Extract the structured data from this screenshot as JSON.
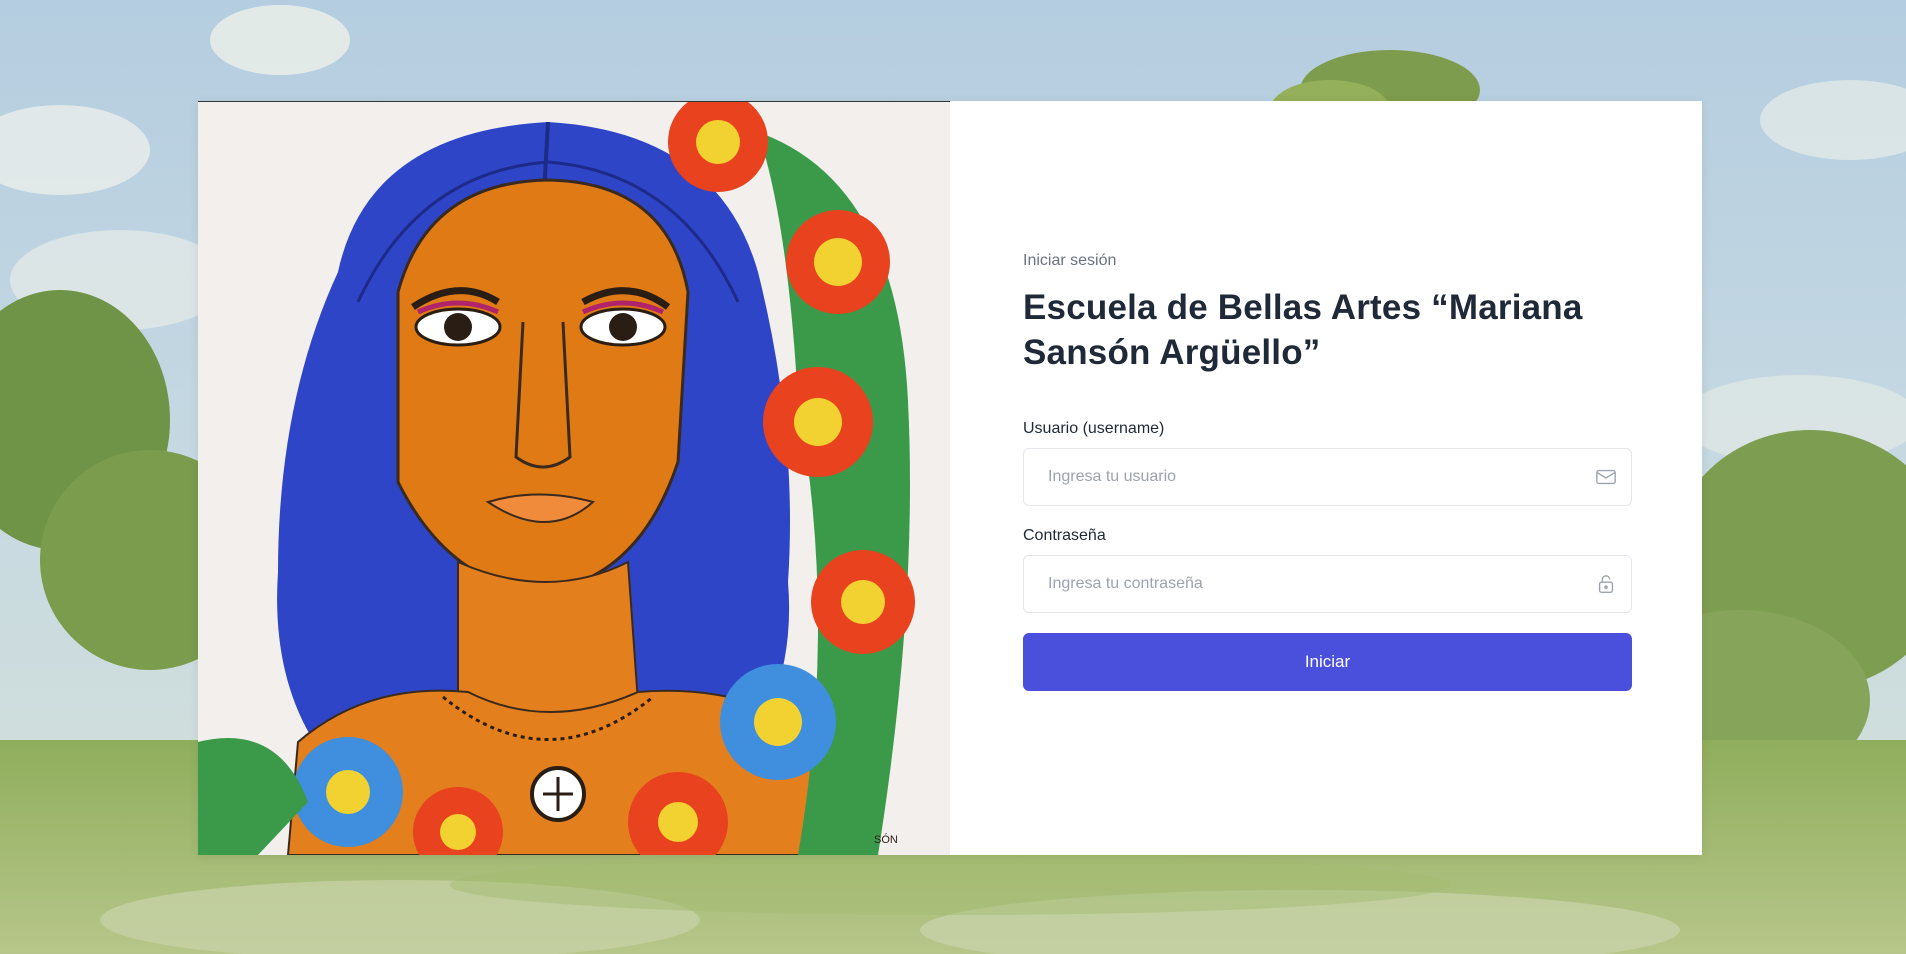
{
  "login": {
    "eyebrow": "Iniciar sesión",
    "title": "Escuela de Bellas Artes “Mariana Sansón Argüello”",
    "username_label": "Usuario (username)",
    "username_placeholder": "Ingresa tu usuario",
    "password_label": "Contraseña",
    "password_placeholder": "Ingresa tu contraseña",
    "submit_label": "Iniciar"
  },
  "icons": {
    "username": "mail-icon",
    "password": "lock-icon"
  },
  "artwork": {
    "signature": "SÓN"
  },
  "colors": {
    "primary": "#4a4fdc",
    "title": "#1f2937",
    "muted": "#6b7280",
    "border": "#e5e7eb"
  }
}
